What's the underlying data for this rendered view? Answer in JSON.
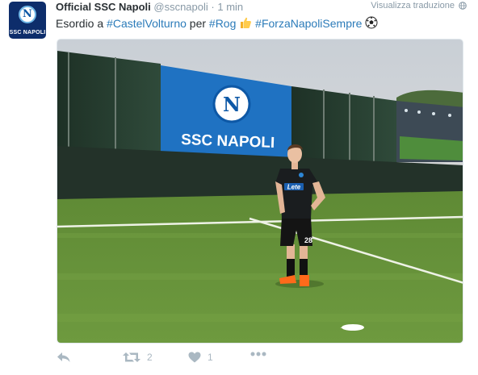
{
  "tweet": {
    "avatar_text": "SSC NAPOLI",
    "avatar_crest_letter": "N",
    "display_name": "Official SSC Napoli",
    "handle": "@sscnapoli",
    "separator": "·",
    "time": "1 min",
    "translate_label": "Visualizza traduzione",
    "text": {
      "part1": "Esordio a ",
      "hashtag1": "#CastelVolturno",
      "part2": " per ",
      "hashtag2": "#Rog",
      "hashtag3": "#ForzaNapoliSempre"
    },
    "emojis": [
      "thumbs-up",
      "soccer-ball"
    ]
  },
  "photo": {
    "banner_letter": "N",
    "banner_text": "SSC NAPOLI",
    "shirt_sponsor": "Lete",
    "shirt_number": "28"
  },
  "actions": {
    "retweet_count": "2",
    "like_count": "1"
  },
  "colors": {
    "brand_blue": "#2b7bb9",
    "napoli_blue": "#1f72c2",
    "muted": "#8899a6",
    "icon": "#aab8c2"
  }
}
